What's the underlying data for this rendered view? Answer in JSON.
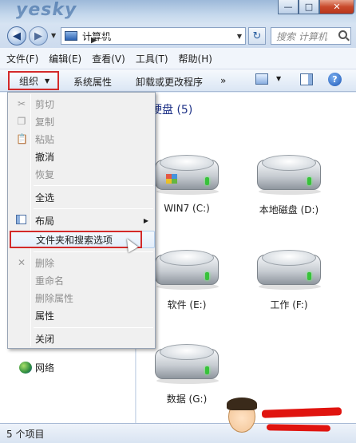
{
  "address": {
    "location": "计算机",
    "search_placeholder": "搜索 计算机"
  },
  "menubar": [
    "文件(F)",
    "编辑(E)",
    "查看(V)",
    "工具(T)",
    "帮助(H)"
  ],
  "toolbar": {
    "organize": "组织",
    "system_properties": "系统属性",
    "uninstall": "卸载或更改程序",
    "more": "»"
  },
  "content": {
    "section_title": "硬盘 (5)",
    "drives": [
      {
        "label": "WIN7 (C:)"
      },
      {
        "label": "本地磁盘 (D:)"
      },
      {
        "label": "软件 (E:)"
      },
      {
        "label": "工作 (F:)"
      },
      {
        "label": "数据 (G:)"
      }
    ]
  },
  "navpane": {
    "network": "网络"
  },
  "menu": {
    "cut": "剪切",
    "copy": "复制",
    "paste": "粘贴",
    "undo": "撤消",
    "redo": "恢复",
    "select_all": "全选",
    "layout": "布局",
    "folder_options": "文件夹和搜索选项",
    "delete": "删除",
    "rename": "重命名",
    "remove_properties": "删除属性",
    "properties": "属性",
    "close": "关闭"
  },
  "statusbar": {
    "text": "5 个项目"
  }
}
